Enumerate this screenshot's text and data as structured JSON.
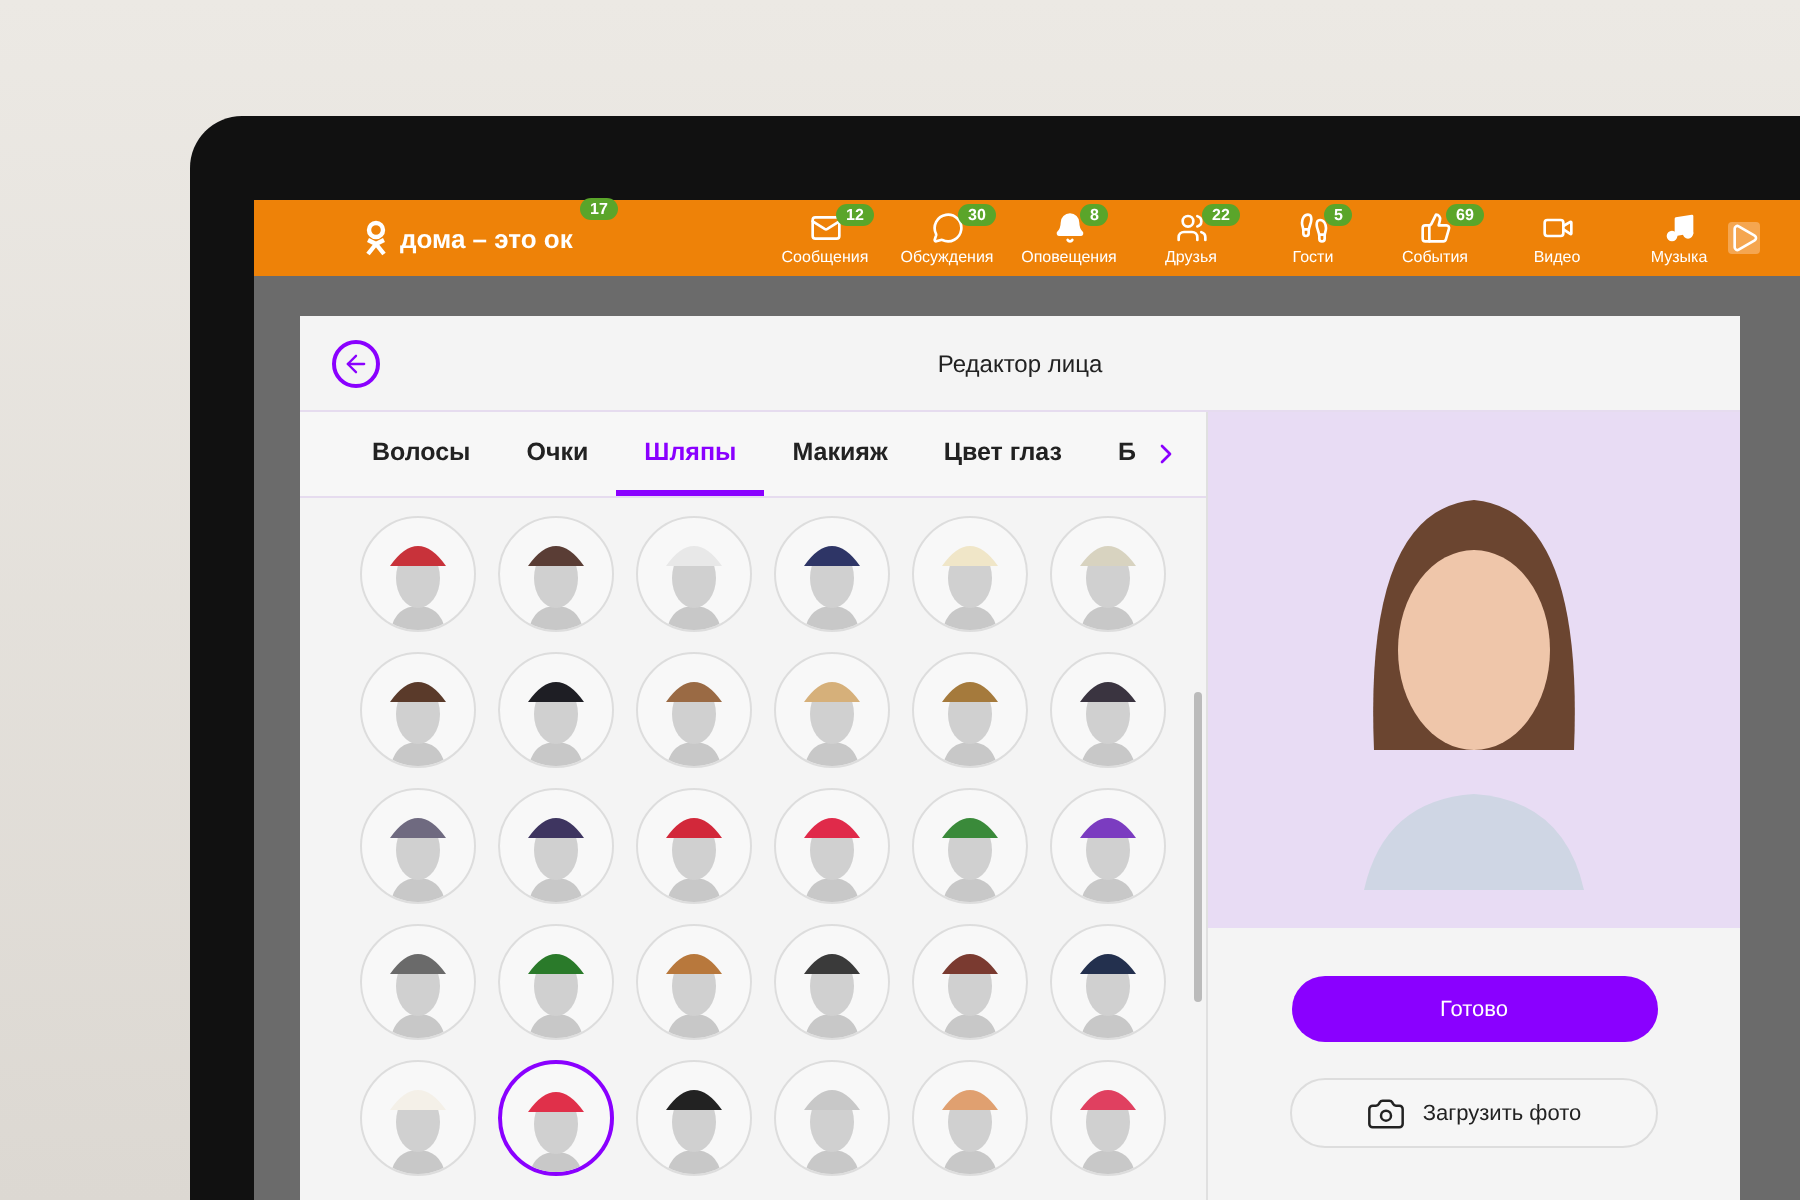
{
  "site": {
    "logo": "дома – это ок",
    "logo_badge": "17"
  },
  "nav": [
    {
      "kind": "mail",
      "label": "Сообщения",
      "badge": "12"
    },
    {
      "kind": "chat",
      "label": "Обсуждения",
      "badge": "30"
    },
    {
      "kind": "bell",
      "label": "Оповещения",
      "badge": "8"
    },
    {
      "kind": "friends",
      "label": "Друзья",
      "badge": "22"
    },
    {
      "kind": "guests",
      "label": "Гости",
      "badge": "5"
    },
    {
      "kind": "events",
      "label": "События",
      "badge": "69"
    },
    {
      "kind": "video",
      "label": "Видео"
    },
    {
      "kind": "music",
      "label": "Музыка"
    }
  ],
  "modal": {
    "title": "Редактор лица",
    "tabs": [
      {
        "label": "Волосы",
        "selected": false
      },
      {
        "label": "Очки",
        "selected": false
      },
      {
        "label": "Шляпы",
        "selected": true
      },
      {
        "label": "Макияж",
        "selected": false
      },
      {
        "label": "Цвет глаз",
        "selected": false
      },
      {
        "label": "Б",
        "selected": false
      }
    ],
    "hats": [
      {
        "color": "#c8323a",
        "selected": false
      },
      {
        "color": "#5a3d35",
        "selected": false
      },
      {
        "color": "#e8e8e8",
        "selected": false
      },
      {
        "color": "#2e3566",
        "selected": false
      },
      {
        "color": "#f0e6c8",
        "selected": false
      },
      {
        "color": "#d8d3c0",
        "selected": false
      },
      {
        "color": "#5a3a2a",
        "selected": false
      },
      {
        "color": "#1e1e24",
        "selected": false
      },
      {
        "color": "#9a6a44",
        "selected": false
      },
      {
        "color": "#d6b07a",
        "selected": false
      },
      {
        "color": "#a57a3c",
        "selected": false
      },
      {
        "color": "#3a3440",
        "selected": false
      },
      {
        "color": "#6f6a80",
        "selected": false
      },
      {
        "color": "#3e3560",
        "selected": false
      },
      {
        "color": "#d2283a",
        "selected": false
      },
      {
        "color": "#e02a4a",
        "selected": false
      },
      {
        "color": "#3a8a3a",
        "selected": false
      },
      {
        "color": "#7b3cc0",
        "selected": false
      },
      {
        "color": "#6a6a6a",
        "selected": false
      },
      {
        "color": "#2a7a2a",
        "selected": false
      },
      {
        "color": "#b8783c",
        "selected": false
      },
      {
        "color": "#3a3a3a",
        "selected": false
      },
      {
        "color": "#7a3a30",
        "selected": false
      },
      {
        "color": "#23304e",
        "selected": false
      },
      {
        "color": "#f4f0e8",
        "selected": false
      },
      {
        "color": "#e0304a",
        "selected": true
      },
      {
        "color": "#222222",
        "selected": false
      },
      {
        "color": "#c8c8c8",
        "selected": false
      },
      {
        "color": "#e0a070",
        "selected": false
      },
      {
        "color": "#e04060",
        "selected": false
      }
    ],
    "done_button": "Готово",
    "upload_button": "Загрузить фото"
  }
}
